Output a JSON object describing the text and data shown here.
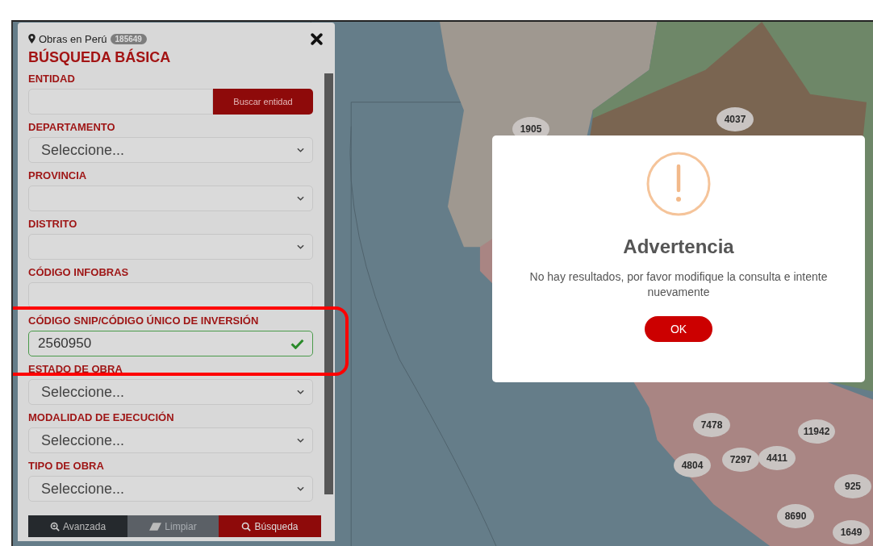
{
  "panel": {
    "heading": "Obras en Perú",
    "count": "185649",
    "title": "BÚSQUEDA BÁSICA",
    "fields": [
      {
        "kind": "input_button",
        "label": "ENTIDAD",
        "button": "Buscar entidad"
      },
      {
        "kind": "select",
        "label": "DEPARTAMENTO",
        "value": "Seleccione..."
      },
      {
        "kind": "select",
        "label": "PROVINCIA"
      },
      {
        "kind": "select",
        "label": "DISTRITO"
      },
      {
        "kind": "input",
        "label": "CÓDIGO INFOBRAS",
        "valid": false
      },
      {
        "kind": "input",
        "label": "CÓDIGO SNIP/CÓDIGO ÚNICO DE INVERSIÓN",
        "value": "2560950",
        "valid": true
      },
      {
        "kind": "select",
        "label": "ESTADO DE OBRA",
        "value": "Seleccione..."
      },
      {
        "kind": "select",
        "label": "MODALIDAD DE EJECUCIÓN",
        "value": "Seleccione..."
      },
      {
        "kind": "select",
        "label": "TIPO DE OBRA",
        "value": "Seleccione..."
      }
    ],
    "actions": [
      {
        "kind": "advanced",
        "label": "Avanzada"
      },
      {
        "kind": "clear",
        "label": "Limpiar"
      },
      {
        "kind": "search",
        "label": "Búsqueda"
      }
    ]
  },
  "map": {
    "clusters": [
      {
        "count": "1905"
      },
      {
        "count": "4037"
      },
      {
        "count": "7478"
      },
      {
        "count": "11942"
      },
      {
        "count": "4804"
      },
      {
        "count": "7297"
      },
      {
        "count": "4411"
      },
      {
        "count": "925"
      },
      {
        "count": "8690"
      },
      {
        "count": "1649"
      }
    ]
  },
  "highlight": true,
  "dialog": {
    "title": "Advertencia",
    "message": "No hay resultados, por favor modifique la consulta e intente nuevamente",
    "button": "OK"
  }
}
